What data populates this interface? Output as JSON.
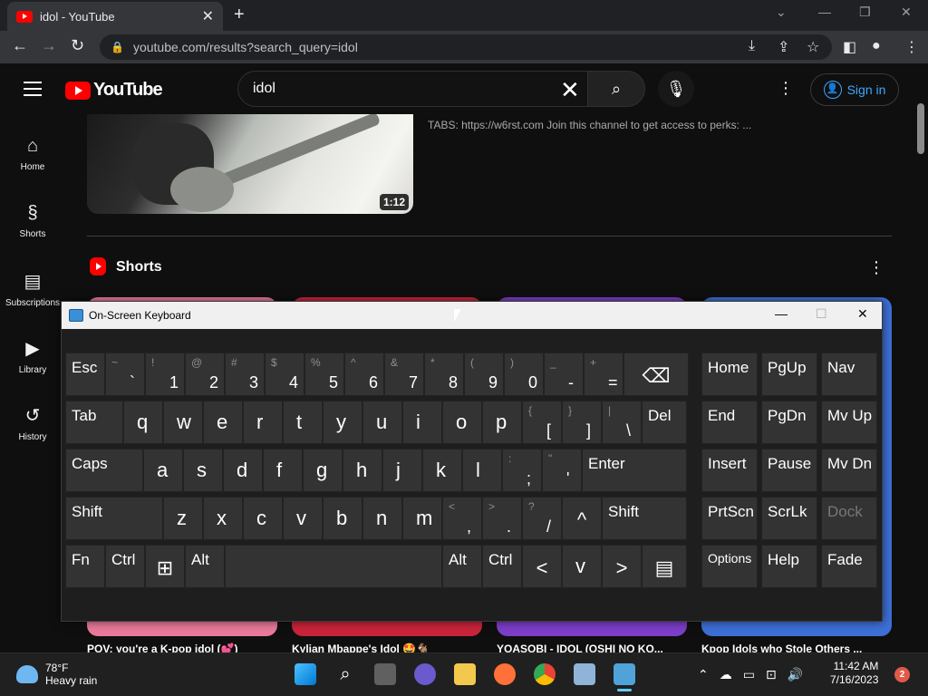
{
  "browser": {
    "tab_title": "idol - YouTube",
    "url": "youtube.com/results?search_query=idol",
    "new_tab": "+"
  },
  "youtube": {
    "logo_text": "YouTube",
    "search_value": "idol",
    "sign_in": "Sign in",
    "sidebar": [
      {
        "label": "Home",
        "icon": "home-icon"
      },
      {
        "label": "Shorts",
        "icon": "shorts-icon"
      },
      {
        "label": "Subscriptions",
        "icon": "subscriptions-icon"
      },
      {
        "label": "Library",
        "icon": "library-icon"
      },
      {
        "label": "History",
        "icon": "history-icon"
      }
    ],
    "video": {
      "duration": "1:12",
      "description": "TABS: https://w6rst.com Join this channel to get access to perks: ..."
    },
    "shorts_title": "Shorts",
    "short_cards": [
      {
        "title": "POV: you're a K-pop idol (💕)",
        "color": "#e97a9b"
      },
      {
        "title": "Kylian Mbappe's Idol 🤩🐐",
        "color": "#c9243a"
      },
      {
        "title": "YOASOBI - IDOL (OSHI NO KO...",
        "color": "#7d3ec9"
      },
      {
        "title": "Kpop Idols who Stole Others ...",
        "color": "#3d6fd6"
      }
    ]
  },
  "osk": {
    "title": "On-Screen Keyboard",
    "rows": [
      [
        {
          "m": "Esc"
        },
        {
          "s": "~",
          "n": "`"
        },
        {
          "s": "!",
          "n": "1"
        },
        {
          "s": "@",
          "n": "2"
        },
        {
          "s": "#",
          "n": "3"
        },
        {
          "s": "$",
          "n": "4"
        },
        {
          "s": "%",
          "n": "5"
        },
        {
          "s": "^",
          "n": "6"
        },
        {
          "s": "&",
          "n": "7"
        },
        {
          "s": "*",
          "n": "8"
        },
        {
          "s": "(",
          "n": "9"
        },
        {
          "s": ")",
          "n": "0"
        },
        {
          "s": "_",
          "n": "-"
        },
        {
          "s": "+",
          "n": "="
        },
        {
          "m": "⌫"
        }
      ],
      [
        {
          "m": "Tab"
        },
        {
          "m": "q"
        },
        {
          "m": "w"
        },
        {
          "m": "e"
        },
        {
          "m": "r"
        },
        {
          "m": "t"
        },
        {
          "m": "y"
        },
        {
          "m": "u"
        },
        {
          "m": "i"
        },
        {
          "m": "o"
        },
        {
          "m": "p"
        },
        {
          "s": "{",
          "n": "["
        },
        {
          "s": "}",
          "n": "]"
        },
        {
          "s": "|",
          "n": "\\"
        },
        {
          "m": "Del"
        }
      ],
      [
        {
          "m": "Caps"
        },
        {
          "m": "a"
        },
        {
          "m": "s"
        },
        {
          "m": "d"
        },
        {
          "m": "f"
        },
        {
          "m": "g"
        },
        {
          "m": "h"
        },
        {
          "m": "j"
        },
        {
          "m": "k"
        },
        {
          "m": "l"
        },
        {
          "s": ":",
          "n": ";"
        },
        {
          "s": "\"",
          "n": "'"
        },
        {
          "m": "Enter"
        }
      ],
      [
        {
          "m": "Shift"
        },
        {
          "m": "z"
        },
        {
          "m": "x"
        },
        {
          "m": "c"
        },
        {
          "m": "v"
        },
        {
          "m": "b"
        },
        {
          "m": "n"
        },
        {
          "m": "m"
        },
        {
          "s": "<",
          "n": ","
        },
        {
          "s": ">",
          "n": "."
        },
        {
          "s": "?",
          "n": "/"
        },
        {
          "m": "^"
        },
        {
          "m": "Shift"
        }
      ],
      [
        {
          "m": "Fn"
        },
        {
          "m": "Ctrl"
        },
        {
          "m": "⊞"
        },
        {
          "m": "Alt"
        },
        {
          "m": ""
        },
        {
          "m": "Alt"
        },
        {
          "m": "Ctrl"
        },
        {
          "m": "<"
        },
        {
          "m": "v"
        },
        {
          "m": ">"
        },
        {
          "m": "▤"
        }
      ]
    ],
    "nav_keys": [
      [
        "Home",
        "PgUp",
        "Nav"
      ],
      [
        "End",
        "PgDn",
        "Mv Up"
      ],
      [
        "Insert",
        "Pause",
        "Mv Dn"
      ],
      [
        "PrtScn",
        "ScrLk",
        "Dock"
      ],
      [
        "Options",
        "Help",
        "Fade"
      ]
    ]
  },
  "taskbar": {
    "temp": "78°F",
    "weather": "Heavy rain",
    "time": "11:42 AM",
    "date": "7/16/2023",
    "notifications": "2"
  }
}
